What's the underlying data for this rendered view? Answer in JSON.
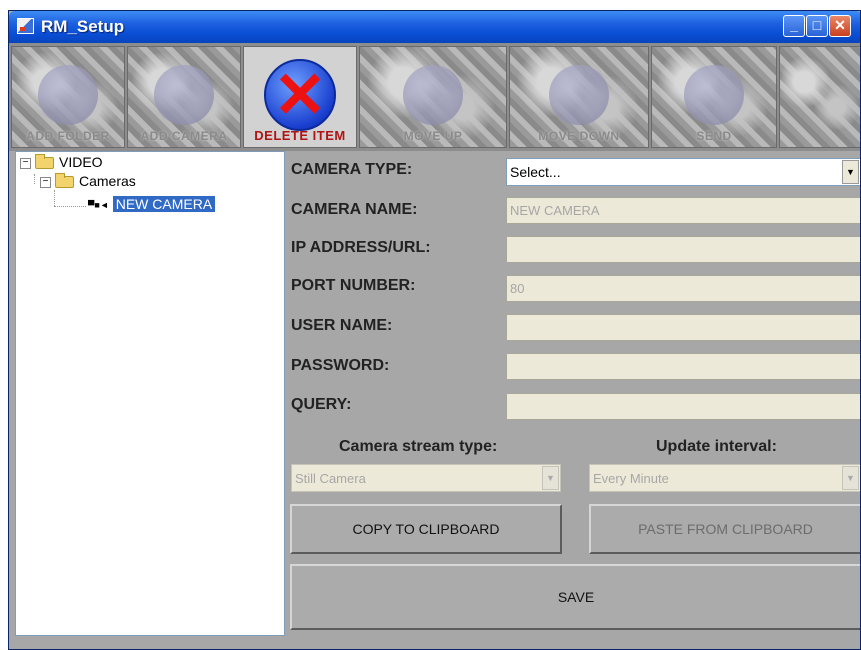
{
  "window": {
    "title": "RM_Setup"
  },
  "toolbar": {
    "tools": [
      {
        "label": "ADD FOLDER",
        "state": "disabled"
      },
      {
        "label": "ADD CAMERA",
        "state": "disabled"
      },
      {
        "label": "DELETE ITEM",
        "state": "enabled"
      },
      {
        "label": "MOVE UP",
        "state": "disabled"
      },
      {
        "label": "MOVE DOWN",
        "state": "disabled"
      },
      {
        "label": "SEND",
        "state": "disabled"
      },
      {
        "label": "",
        "state": "disabled"
      }
    ]
  },
  "tree": {
    "root": "VIDEO",
    "folder": "Cameras",
    "item": "NEW CAMERA",
    "item_icon": "camera-icon"
  },
  "form": {
    "camera_type_label": "CAMERA TYPE:",
    "camera_type_value": "Select...",
    "camera_name_label": "CAMERA NAME:",
    "camera_name_value": "NEW CAMERA",
    "ip_label": "IP ADDRESS/URL:",
    "ip_value": "",
    "port_label": "PORT NUMBER:",
    "port_value": "80",
    "user_label": "USER NAME:",
    "user_value": "",
    "password_label": "PASSWORD:",
    "password_value": "",
    "query_label": "QUERY:",
    "query_value": ""
  },
  "stream": {
    "heading": "Camera stream type:",
    "value": "Still Camera"
  },
  "interval": {
    "heading": "Update interval:",
    "value": "Every Minute"
  },
  "buttons": {
    "copy": "COPY TO CLIPBOARD",
    "paste": "PASTE FROM CLIPBOARD",
    "save": "SAVE"
  },
  "colors": {
    "titlebar": "#0a4fd6",
    "selection": "#316ac5",
    "panel": "#a7a7a7",
    "delete_x": "#ee1111"
  }
}
